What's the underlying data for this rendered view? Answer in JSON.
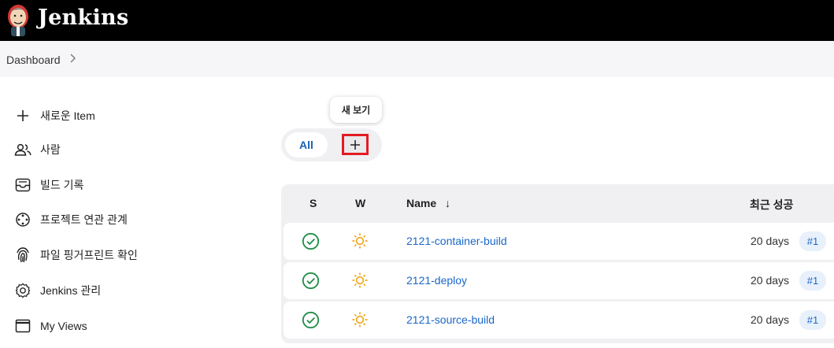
{
  "header": {
    "brand": "Jenkins",
    "logo_icon": "jenkins-butler-logo"
  },
  "breadcrumb": {
    "items": [
      "Dashboard"
    ]
  },
  "sidebar": {
    "items": [
      {
        "label": "새로운 Item",
        "icon": "plus-icon"
      },
      {
        "label": "사람",
        "icon": "people-icon"
      },
      {
        "label": "빌드 기록",
        "icon": "inbox-icon"
      },
      {
        "label": "프로젝트 연관 관계",
        "icon": "relationship-icon"
      },
      {
        "label": "파일 핑거프린트 확인",
        "icon": "fingerprint-icon"
      },
      {
        "label": "Jenkins 관리",
        "icon": "gear-icon"
      },
      {
        "label": "My Views",
        "icon": "window-icon"
      }
    ]
  },
  "views": {
    "tabs": [
      "All"
    ],
    "new_view_tooltip": "새 보기",
    "new_view_icon": "plus-icon"
  },
  "table": {
    "headers": {
      "s": "S",
      "w": "W",
      "name": "Name",
      "name_sort": "↓",
      "last_success": "최근 성공"
    },
    "rows": [
      {
        "name": "2121-container-build",
        "status": "success",
        "weather": "sunny",
        "last_success": "20 days",
        "build": "#1"
      },
      {
        "name": "2121-deploy",
        "status": "success",
        "weather": "sunny",
        "last_success": "20 days",
        "build": "#1"
      },
      {
        "name": "2121-source-build",
        "status": "success",
        "weather": "sunny",
        "last_success": "20 days",
        "build": "#1"
      }
    ]
  },
  "colors": {
    "header_bg": "#000000",
    "link": "#1a66c9",
    "success": "#1e8c45",
    "sun": "#f0a61c",
    "highlight": "#e31b23"
  }
}
